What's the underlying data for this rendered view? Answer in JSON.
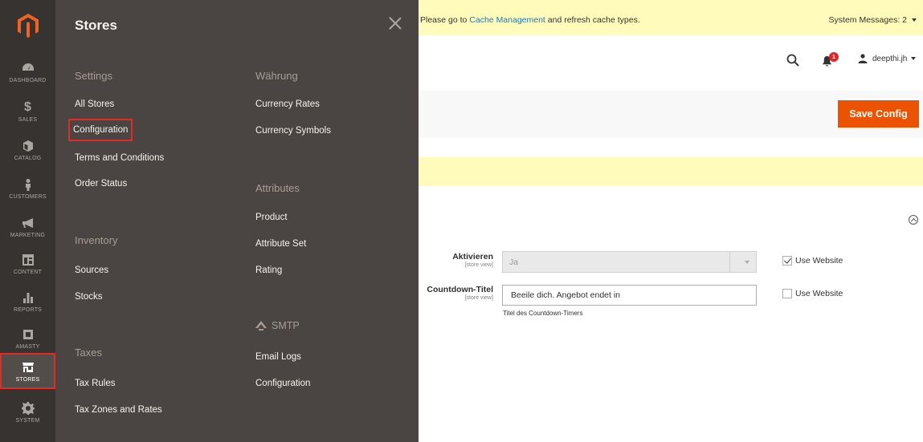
{
  "colors": {
    "nav_bg": "#373330",
    "panel_bg": "#4a4542",
    "accent": "#eb5202",
    "message_bg": "#fffbbb",
    "link": "#1979c3",
    "highlight": "#e02b27"
  },
  "admin_nav": {
    "logo_icon": "magento-logo-icon",
    "items": [
      {
        "label": "DASHBOARD",
        "icon": "dashboard-icon"
      },
      {
        "label": "SALES",
        "icon": "dollar-icon"
      },
      {
        "label": "CATALOG",
        "icon": "cube-icon"
      },
      {
        "label": "CUSTOMERS",
        "icon": "person-icon"
      },
      {
        "label": "MARKETING",
        "icon": "megaphone-icon"
      },
      {
        "label": "CONTENT",
        "icon": "layout-icon"
      },
      {
        "label": "REPORTS",
        "icon": "bar-chart-icon"
      },
      {
        "label": "AMASTY",
        "icon": "amasty-icon"
      },
      {
        "label": "STORES",
        "icon": "store-icon"
      },
      {
        "label": "SYSTEM",
        "icon": "gear-icon"
      }
    ]
  },
  "stores_panel": {
    "title": "Stores",
    "col1": {
      "settings_title": "Settings",
      "settings_links": [
        "All Stores",
        "Configuration",
        "Terms and Conditions",
        "Order Status"
      ],
      "inventory_title": "Inventory",
      "inventory_links": [
        "Sources",
        "Stocks"
      ],
      "taxes_title": "Taxes",
      "taxes_links": [
        "Tax Rules",
        "Tax Zones and Rates"
      ]
    },
    "col2": {
      "currency_title": "Währung",
      "currency_links": [
        "Currency Rates",
        "Currency Symbols"
      ],
      "attributes_title": "Attributes",
      "attributes_links": [
        "Product",
        "Attribute Set",
        "Rating"
      ],
      "smtp_title": "SMTP",
      "smtp_links": [
        "Email Logs",
        "Configuration"
      ]
    }
  },
  "message_bar": {
    "prefix": "Please go to ",
    "link": "Cache Management",
    "suffix": " and refresh cache types.",
    "system_messages": "System Messages: 2"
  },
  "header": {
    "notification_count": "1",
    "username": "deepthi.jh"
  },
  "actions": {
    "save_label": "Save Config"
  },
  "form": {
    "aktivieren": {
      "label": "Aktivieren",
      "scope": "[store view]",
      "value": "Ja",
      "use_website": "Use Website",
      "use_website_checked": true
    },
    "countdown": {
      "label": "Countdown-Titel",
      "scope": "[store view]",
      "value": "Beeile dich. Angebot endet in",
      "note": "Titel des Countdown-Timers",
      "use_website": "Use Website",
      "use_website_checked": false
    }
  }
}
